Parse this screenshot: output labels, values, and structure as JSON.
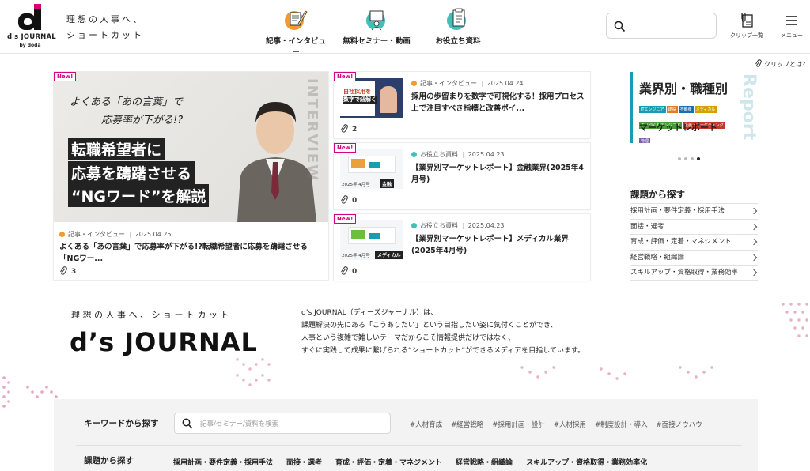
{
  "header": {
    "logo_text": "d's JOURNAL",
    "logo_sub": "by doda",
    "tagline": "理想の人事へ、\nショートカット",
    "nav": [
      {
        "label": "記事・インタビュー",
        "icon": "pen-icon"
      },
      {
        "label": "無料セミナー・動画",
        "icon": "seminar-icon"
      },
      {
        "label": "お役立ち資料",
        "icon": "document-icon"
      }
    ],
    "clip_label": "クリップ一覧",
    "menu_label": "メニュー"
  },
  "clip_what": "クリップとは？",
  "featured": {
    "badge": "New!",
    "image_lines": {
      "head1": "よくある「あの言葉」で",
      "head2": "応募率が下がる!?",
      "line1": "転職希望者に",
      "line2": "応募を躊躇させる",
      "line3": "“NGワード”を解説",
      "side": "INTERVIEW"
    },
    "category": "記事・インタビュー",
    "date": "2025.04.25",
    "title": "よくある「あの言葉」で応募率が下がる!?転職希望者に応募を躊躇させる「NGワー...",
    "clips": "3"
  },
  "articles": [
    {
      "badge": "New!",
      "category": "記事・インタビュー",
      "category_color": "#f29a2e",
      "date": "2025.04.24",
      "title": "採用の歩留まりを数字で可視化する！採用プロセス上で注目すべき指標と改善ポイ...",
      "clips": "2",
      "thumb_text1": "自社採用を",
      "thumb_text2": "数字で紐解く"
    },
    {
      "badge": "New!",
      "category": "お役立ち資料",
      "category_color": "#3fc1b8",
      "date": "2025.04.23",
      "title": "【業界別マーケットレポート】金融業界(2025年4月号)",
      "clips": "0",
      "thumb_label": "金融",
      "thumb_date": "2025年 4月号"
    },
    {
      "badge": "New!",
      "category": "お役立ち資料",
      "category_color": "#3fc1b8",
      "date": "2025.04.23",
      "title": "【業界別マーケットレポート】メディカル業界(2025年4月号)",
      "clips": "0",
      "thumb_label": "メディカル",
      "thumb_date": "2025年 4月号"
    }
  ],
  "report_banner": {
    "title": "業界別・職種別",
    "subtitle": "マーケットレポート",
    "side_word": "Report",
    "tags": [
      {
        "label": "ITエンジニア",
        "color": "#1a9cb0"
      },
      {
        "label": "建設",
        "color": "#e07b2b"
      },
      {
        "label": "不動産",
        "color": "#1a6fb0"
      },
      {
        "label": "メディカル",
        "color": "#d4a100"
      },
      {
        "label": "モノづくりエンジニア",
        "color": "#4a9a3a"
      },
      {
        "label": "企画・マーケティング",
        "color": "#c0392b"
      },
      {
        "label": "管理",
        "color": "#7d5ba6"
      }
    ],
    "slides": 4,
    "active_slide": 4
  },
  "issues": {
    "title": "課題から探す",
    "items": [
      "採用計画・要件定義・採用手法",
      "面接・選考",
      "育成・評価・定着・マネジメント",
      "経営戦略・組織論",
      "スキルアップ・資格取得・業務効率"
    ]
  },
  "intro": {
    "tagline": "理想の人事へ、ショートカット",
    "logo": "d’s JOURNAL",
    "lines": [
      "d’s JOURNAL（ディーズジャーナル）は、",
      "課題解決の先にある「こうありたい」という目指したい姿に気付くことができ、",
      "人事という複雑で難しいテーマだからこそ情報提供だけではなく、",
      "すぐに実践して成果に繋げられる“ショートカット”ができるメディアを目指しています。"
    ]
  },
  "search_panel": {
    "keyword_label": "キーワードから探す",
    "placeholder": "記事/セミナー/資料を検索",
    "hashtags": [
      "#人材育成",
      "#経営戦略",
      "#採用計画・設計",
      "#人材採用",
      "#制度設計・導入",
      "#面接ノウハウ"
    ],
    "issue_label": "課題から探す",
    "issue_links": [
      "採用計画・要件定義・採用手法",
      "面接・選考",
      "育成・評価・定着・マネジメント",
      "経営戦略・組織論",
      "スキルアップ・資格取得・業務効率化"
    ]
  },
  "colors": {
    "accent": "#d9007e",
    "orange": "#f29a2e",
    "teal": "#3fc1b8",
    "report_bar": "#1a9cb0"
  }
}
